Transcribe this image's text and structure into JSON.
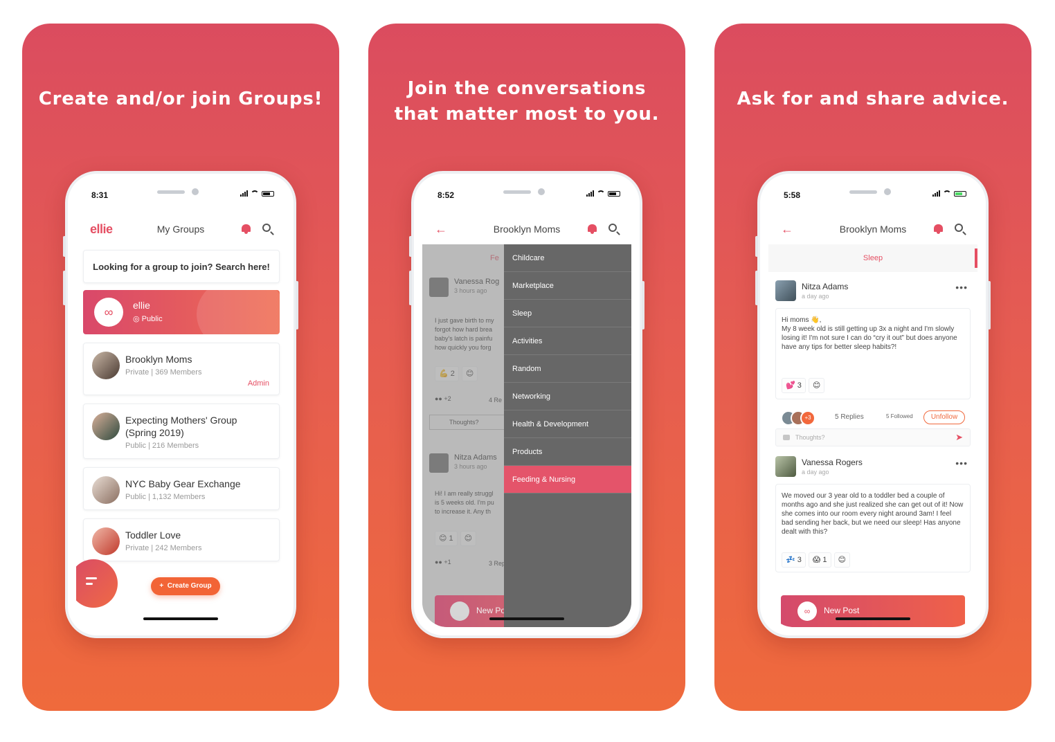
{
  "panels": [
    {
      "headline": "Create and/or join Groups!"
    },
    {
      "headline_line1": "Join the conversations",
      "headline_line2": "that matter most to you."
    },
    {
      "headline": "Ask for and share advice."
    }
  ],
  "screen1": {
    "time": "8:31",
    "logo": "ellie",
    "title": "My Groups",
    "search_prompt": "Looking for a group to join? Search here!",
    "featured": {
      "name": "ellie",
      "privacy": "Public"
    },
    "groups": [
      {
        "name": "Brooklyn Moms",
        "meta": "Private  |  369 Members",
        "role": "Admin"
      },
      {
        "name": "Expecting Mothers' Group (Spring 2019)",
        "meta": "Public  |  216 Members"
      },
      {
        "name": "NYC Baby Gear Exchange",
        "meta": "Public  |  1,132 Members"
      },
      {
        "name": "Toddler Love",
        "meta": "Private  |  242 Members"
      }
    ],
    "create_button": "Create Group"
  },
  "screen2": {
    "time": "8:52",
    "title": "Brooklyn Moms",
    "tab_partial": "Fe",
    "menu": [
      "Childcare",
      "Marketplace",
      "Sleep",
      "Activities",
      "Random",
      "Networking",
      "Health & Development",
      "Products",
      "Feeding & Nursing"
    ],
    "active_index": 8,
    "dim_posts": [
      {
        "author": "Vanessa Rog",
        "time": "3 hours ago",
        "text": "I just gave birth to my\nforgot how hard brea\nbaby's latch is painfu\nhow quickly you forg",
        "react_count": "2",
        "replies": "4 Re",
        "more_count": "+2"
      },
      {
        "author": "Nitza Adams",
        "time": "3 hours ago",
        "text": "Hi! I am really struggl\nis 5 weeks old. I'm pu\nto increase it. Any th",
        "react_count": "1",
        "replies": "3 Rep",
        "more_count": "+1"
      }
    ],
    "thoughts_placeholder": "Thoughts?",
    "new_post_partial": "New Po"
  },
  "screen3": {
    "time": "5:58",
    "title": "Brooklyn Moms",
    "tab": "Sleep",
    "posts": [
      {
        "author": "Nitza Adams",
        "time": "a day ago",
        "text": "Hi moms 👋,\nMy 8 week old is still getting up 3x a night and I'm slowly losing it! I'm not sure I can do “cry it out” but does anyone have any tips for better sleep habits?!",
        "reactions": [
          {
            "emoji": "💕",
            "count": "3"
          }
        ],
        "avatars_more": "+3",
        "replies": "5 Replies",
        "followed": "5 Followed",
        "follow_button": "Unfollow"
      },
      {
        "author": "Vanessa Rogers",
        "time": "a day ago",
        "text": "We moved our 3 year old to a toddler bed a couple of months ago and she just realized she can get out of it! Now she comes into our room every night around 3am! I feel bad sending her back, but we need our sleep! Has anyone dealt with this?",
        "reactions": [
          {
            "emoji": "💤",
            "count": "3"
          },
          {
            "emoji": "😱",
            "count": "1"
          }
        ]
      }
    ],
    "thoughts_placeholder": "Thoughts?",
    "new_post": "New Post"
  },
  "colors": {
    "brand": "#e54f63",
    "accent_orange": "#f26436",
    "drawer": "#676767"
  }
}
